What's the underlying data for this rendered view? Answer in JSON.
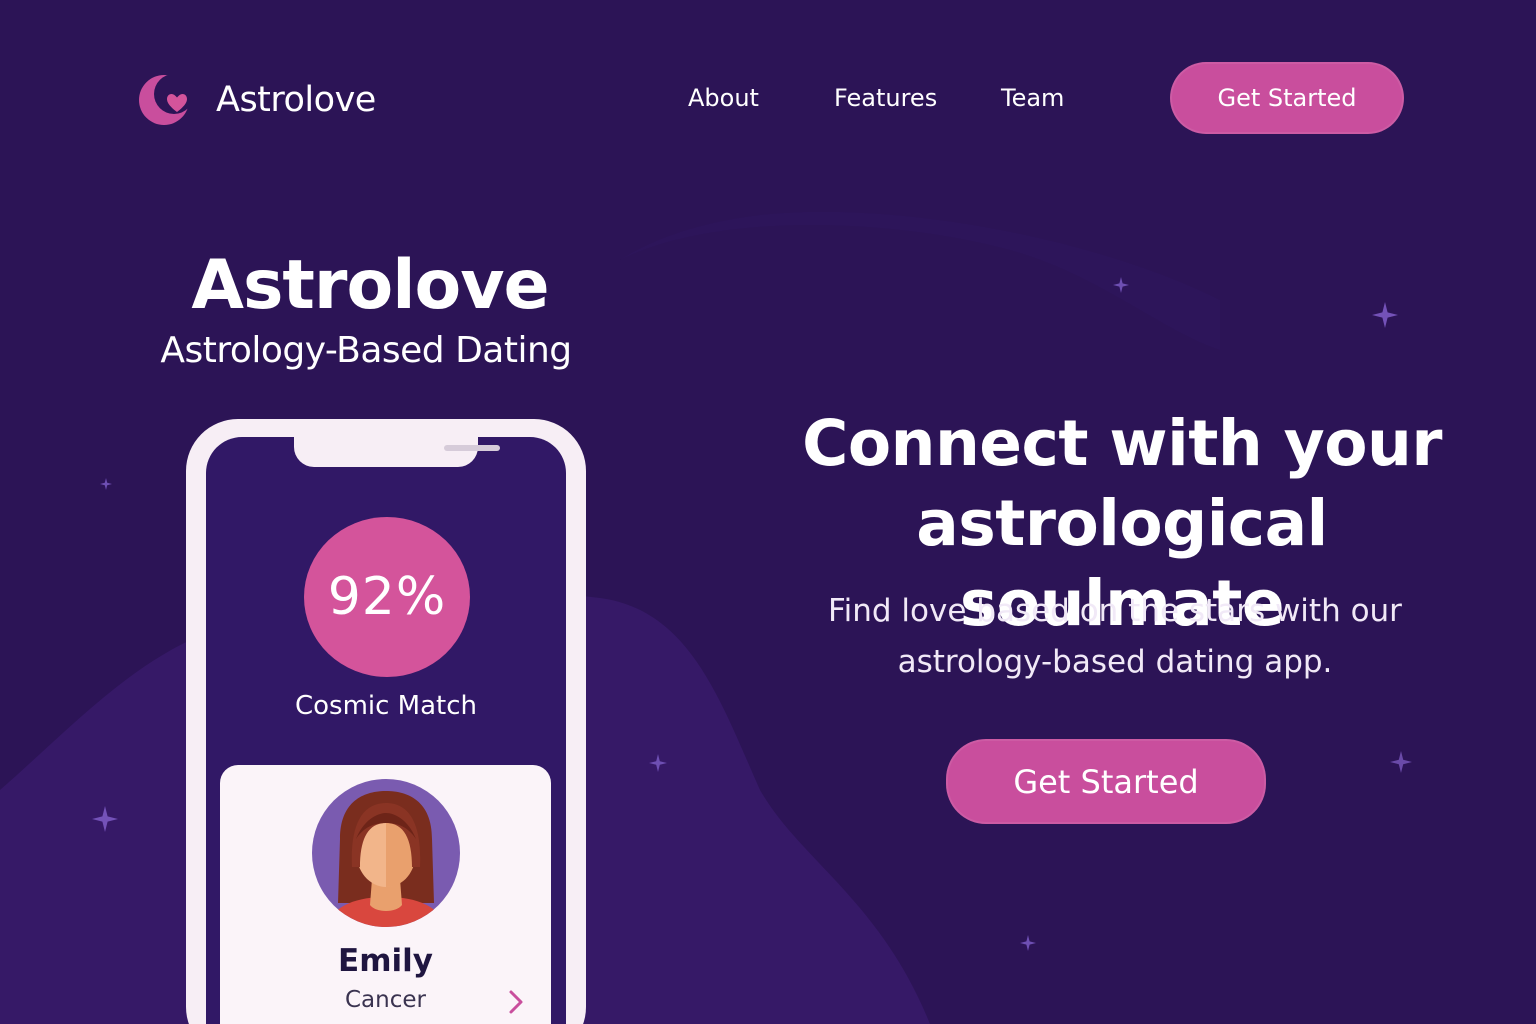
{
  "header": {
    "logo_text": "Astrolove",
    "nav": [
      "About",
      "Features",
      "Team"
    ],
    "cta_label": "Get Started"
  },
  "brand": {
    "title": "Astrolove",
    "subtitle": "Astrology-Based Dating"
  },
  "phone": {
    "match_percent": "92%",
    "match_label": "Cosmic Match",
    "profile": {
      "name": "Emily",
      "sign": "Cancer"
    }
  },
  "hero": {
    "title_line1": "Connect with your",
    "title_line2": "astrological soulmate",
    "description_line1": "Find love based on the stars with our",
    "description_line2": "astrology-based dating app.",
    "cta_label": "Get Started"
  },
  "icons": {
    "logo": "crescent-moon-heart-icon",
    "chevron": "chevron-right-icon",
    "decor": "sparkle-star-icon"
  },
  "colors": {
    "background": "#2c1456",
    "accent": "#c94e9d",
    "phone_frame": "#f7eef5",
    "phone_screen": "#311866",
    "card": "#fbf4f9"
  }
}
